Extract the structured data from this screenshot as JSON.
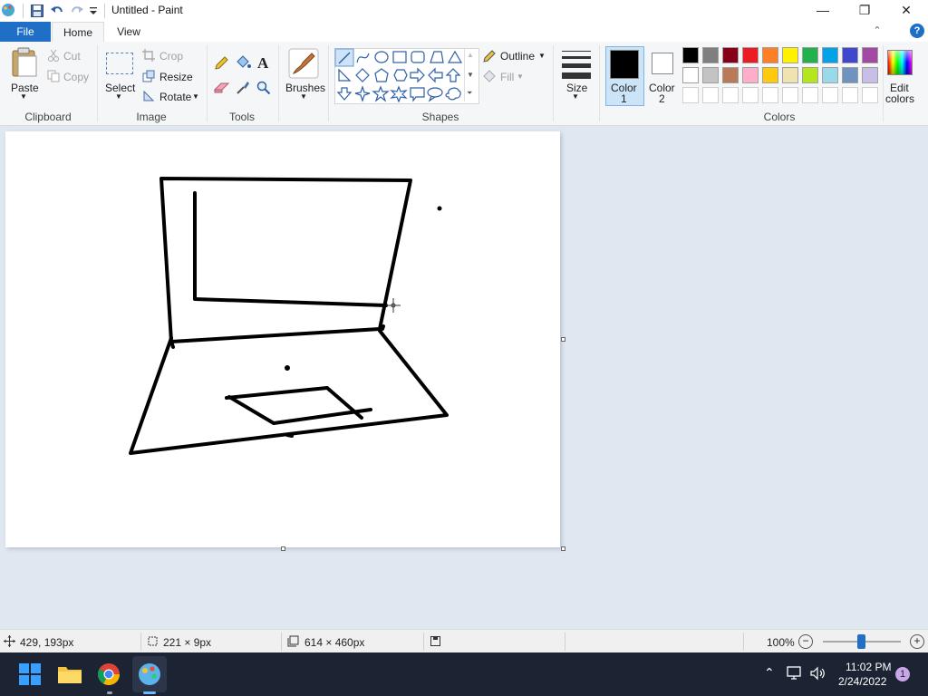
{
  "window": {
    "title": "Untitled - Paint",
    "minimize_glyph": "—",
    "maximize_glyph": "❐",
    "close_glyph": "✕"
  },
  "tabs": {
    "file": "File",
    "home": "Home",
    "view": "View"
  },
  "ribbon": {
    "clipboard": {
      "paste": "Paste",
      "cut": "Cut",
      "copy": "Copy",
      "label": "Clipboard"
    },
    "image": {
      "select": "Select",
      "crop": "Crop",
      "resize": "Resize",
      "rotate": "Rotate",
      "label": "Image"
    },
    "tools": {
      "label": "Tools"
    },
    "brushes": {
      "label": "Brushes"
    },
    "shapes": {
      "outline": "Outline",
      "fill": "Fill",
      "label": "Shapes"
    },
    "size": {
      "label": "Size"
    },
    "color1": {
      "line1": "Color",
      "line2": "1"
    },
    "color2": {
      "line1": "Color",
      "line2": "2"
    },
    "colors": {
      "label": "Colors",
      "edit_line1": "Edit",
      "edit_line2": "colors",
      "row1": [
        "#000000",
        "#7f7f7f",
        "#880015",
        "#ed1c24",
        "#ff7f27",
        "#fff200",
        "#22b14c",
        "#00a2e8",
        "#3f48cc",
        "#a349a4"
      ],
      "row2": [
        "#ffffff",
        "#c3c3c3",
        "#b97a57",
        "#ffaec9",
        "#ffc90e",
        "#efe4b0",
        "#b5e61d",
        "#99d9ea",
        "#7092be",
        "#c8bfe7"
      ],
      "color1_value": "#000000",
      "color2_value": "#ffffff"
    }
  },
  "status": {
    "cursor_pos": "429, 193px",
    "selection_size": "221 × 9px",
    "canvas_size": "614 × 460px",
    "zoom": "100%"
  },
  "taskbar": {
    "time": "11:02 PM",
    "date": "2/24/2022",
    "notification_count": "1"
  }
}
